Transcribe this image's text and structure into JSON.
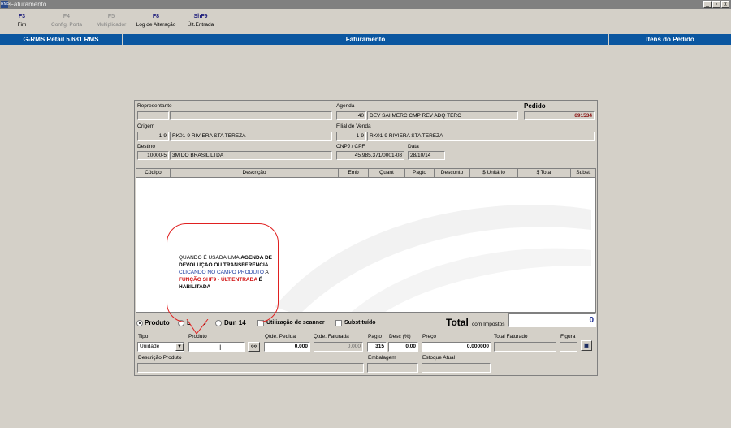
{
  "window": {
    "title": "Faturamento",
    "icon": "app-icon",
    "buttons": [
      "_",
      "▫",
      "x"
    ]
  },
  "function_keys": [
    {
      "key": "F3",
      "label": "Fim",
      "enabled": true
    },
    {
      "key": "F4",
      "label": "Config. Porta",
      "enabled": false
    },
    {
      "key": "F5",
      "label": "Multiplicador",
      "enabled": false
    },
    {
      "key": "F8",
      "label": "Log de Alteração",
      "enabled": true
    },
    {
      "key": "ShF9",
      "label": "Últ.Entrada",
      "enabled": true
    }
  ],
  "header": {
    "left": "G-RMS Retail 5.681 RMS",
    "center": "Faturamento",
    "right": "Itens do Pedido",
    "color": "#0a56a0"
  },
  "form": {
    "representante": {
      "label": "Representante",
      "code": "",
      "name": ""
    },
    "agenda": {
      "label": "Agenda",
      "code": "40",
      "name": "DEV SAI MERC CMP REV ADQ TERC"
    },
    "pedido": {
      "label": "Pedido",
      "value": "691534"
    },
    "origem": {
      "label": "Origem",
      "code": "1-9",
      "name": "RK01-9 RIVIERA STA TEREZA"
    },
    "filial": {
      "label": "Filial de Venda",
      "code": "1-9",
      "name": "RK01-9 RIVIERA STA TEREZA"
    },
    "destino": {
      "label": "Destino",
      "code": "10000-5",
      "name": "3M DO BRASIL LTDA"
    },
    "cnpj": {
      "label": "CNPJ / CPF",
      "value": "45.985.371/0001-08"
    },
    "data": {
      "label": "Data",
      "value": "28/10/14"
    }
  },
  "grid": {
    "columns": [
      "Código",
      "Descrição",
      "Emb",
      "Quant",
      "Pagto",
      "Desconto",
      "$ Unitário",
      "$ Total",
      "Subst."
    ]
  },
  "callout": {
    "p1": "QUANDO É USADA UMA ",
    "p1b": "AGENDA DE DEVOLUÇÃO OU TRANSFERÊNCIA",
    "p2": "CLICANDO NO CAMPO PRODUTO",
    "p3": " A ",
    "p4": "FUNÇÃO SHF9 - ÚLT.ENTRADA",
    "p5": " É HABILITADA"
  },
  "options": {
    "produto": "Produto",
    "ean13": "Ean13",
    "dun14": "Dun 14",
    "selected": "Produto",
    "scanner": "Utilização de scanner",
    "substituido": "Substituído"
  },
  "total": {
    "label": "Total",
    "sub": "com Impostos",
    "value": "0"
  },
  "entry": {
    "tipo": {
      "label": "Tipo",
      "value": "Unidade"
    },
    "produto": {
      "label": "Produto",
      "value": ""
    },
    "qtde_pedida": {
      "label": "Qtde. Pedida",
      "value": "0,000"
    },
    "qtde_faturada": {
      "label": "Qtde. Faturada",
      "value": "0,000"
    },
    "pagto": {
      "label": "Pagto",
      "value": "315"
    },
    "desc": {
      "label": "Desc (%)",
      "value": "0,00"
    },
    "preco": {
      "label": "Preço",
      "value": "0,000000"
    },
    "total_faturado": {
      "label": "Total Faturado",
      "value": ""
    },
    "figura": {
      "label": "Figura",
      "value": ""
    },
    "descricao_produto": {
      "label": "Descrição Produto",
      "value": ""
    },
    "embalagem": {
      "label": "Embalagem",
      "value": ""
    },
    "estoque_atual": {
      "label": "Estoque Atual",
      "value": ""
    }
  }
}
